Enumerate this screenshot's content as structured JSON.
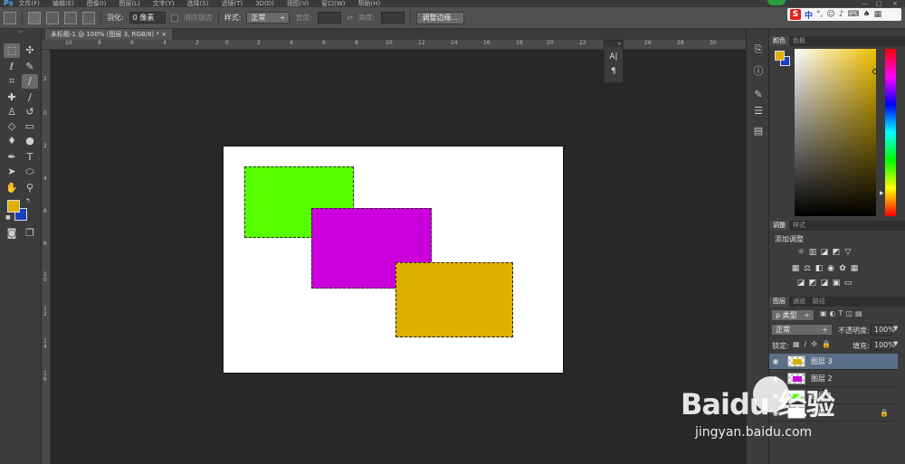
{
  "menubar": {
    "logo": "Ps",
    "items": [
      "文件(F)",
      "编辑(E)",
      "图像(I)",
      "图层(L)",
      "文字(Y)",
      "选择(S)",
      "滤镜(T)",
      "3D(D)",
      "视图(V)",
      "窗口(W)",
      "帮助(H)"
    ]
  },
  "options": {
    "feather_label": "羽化:",
    "feather_value": "0 像素",
    "antialias_label": "消除锯齿",
    "style_label": "样式:",
    "style_value": "正常",
    "width_label": "宽度:",
    "height_label": "高度:",
    "refine_edge_button": "调整边缘..."
  },
  "ime": {
    "logo": "S",
    "lang": "中",
    "punct": "°,",
    "icons": [
      "smiley-icon",
      "mic-icon",
      "keyboard-icon",
      "shirt-icon",
      "grid-icon"
    ]
  },
  "document": {
    "tab_title": "未标题-1 @ 100% (图层 3, RGB/8) *",
    "tab_close": "×"
  },
  "rulers": {
    "top_ticks": [
      "10",
      "8",
      "6",
      "4",
      "2",
      "0",
      "2",
      "4",
      "6",
      "8",
      "10",
      "12",
      "14",
      "16",
      "18",
      "20",
      "22",
      "24",
      "26",
      "28",
      "30"
    ],
    "left_ticks": [
      "2",
      "0",
      "2",
      "4",
      "6",
      "8",
      "10",
      "12",
      "14",
      "16"
    ]
  },
  "canvas": {
    "background": "#ffffff",
    "shapes": [
      {
        "name": "green-rectangle",
        "color": "#55ff00"
      },
      {
        "name": "magenta-rectangle",
        "color": "#cc00dd"
      },
      {
        "name": "gold-rectangle",
        "color": "#ddb000"
      }
    ]
  },
  "mini_panel": {
    "character": "A|",
    "paragraph": "¶"
  },
  "colors": {
    "foreground": "#e0b000",
    "background": "#1a3fbf",
    "accent_selected_layer": "#5a6f86"
  },
  "color_panel": {
    "tabs": [
      "颜色",
      "色板"
    ]
  },
  "adjust_panel": {
    "tabs": [
      "调整",
      "样式"
    ],
    "title": "添加调整"
  },
  "layers_panel": {
    "tabs": [
      "图层",
      "通道",
      "路径"
    ],
    "filter_value": "ρ 类型",
    "blend_mode": "正常",
    "opacity_label": "不透明度:",
    "opacity_value": "100%",
    "lock_label": "锁定:",
    "fill_label": "填充:",
    "fill_value": "100%",
    "layers": [
      {
        "name": "图层 3",
        "thumb_color": "#ddb000",
        "selected": true
      },
      {
        "name": "图层 2",
        "thumb_color": "#cc00dd",
        "selected": false
      },
      {
        "name": "图层 1",
        "thumb_color": "#55ff00",
        "selected": false
      },
      {
        "name": "背景",
        "thumb_color": "#ffffff",
        "selected": false
      }
    ]
  },
  "watermark": {
    "logo_text": "Baidu 经验",
    "url": "jingyan.baidu.com"
  }
}
